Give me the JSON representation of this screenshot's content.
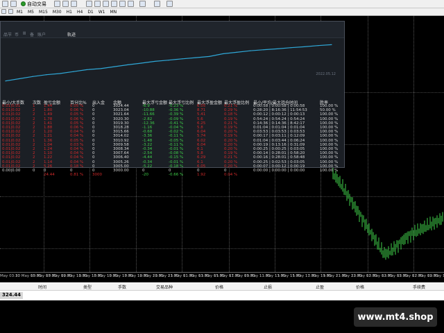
{
  "toolbar": {
    "auto_trading_label": "自动交易",
    "timeframes": [
      "M1",
      "M5",
      "M15",
      "M30",
      "H1",
      "H4",
      "D1",
      "W1",
      "MN"
    ]
  },
  "panel": {
    "tabs": [
      "品",
      "节",
      "币",
      "Ⅲ",
      "备",
      "账户",
      "轨迹"
    ],
    "active_tab_index": 6,
    "equity_date": "2022.05.12"
  },
  "stats": {
    "headers": [
      "最小/大手数",
      "次数",
      "盈亏金额",
      "百分比%",
      "出入金",
      "余额",
      "最大浮亏金额",
      "最大浮亏比例",
      "最大浮盈金额",
      "最大浮盈比例",
      "最小/平均/最大持仓时间",
      "胜率"
    ],
    "rows": [
      [
        "0.01|0.01",
        "1",
        "1.44",
        "0.05 %",
        "0",
        "3024.44",
        "-6.9",
        "-0.23 %",
        "6.05",
        "0.21 %",
        "0:00:58 | 0:00:58 | 0:00:58",
        "100.00 %"
      ],
      [
        "0.01|0.02",
        "2",
        "1.80",
        "0.06 %",
        "0",
        "3023.04",
        "-10.88",
        "-0.36 %",
        "8.71",
        "0.29 %",
        "0:28:20 | 8:16:36 | 11:54:53",
        "50.00 %"
      ],
      [
        "0.01|0.02",
        "2",
        "1.49",
        "0.05 %",
        "0",
        "3021.64",
        "-11.66",
        "-0.39 %",
        "5.41",
        "0.18 %",
        "0:00:12 | 0:00:12 | 0:00:13",
        "100.00 %"
      ],
      [
        "0.01|0.02",
        "2",
        "1.78",
        "0.06 %",
        "0",
        "3020.30",
        "-2.82",
        "-0.09 %",
        "5.6",
        "0.19 %",
        "0:54:24 | 0:54:24 | 0:54:24",
        "100.00 %"
      ],
      [
        "0.01|0.02",
        "2",
        "1.41",
        "0.05 %",
        "0",
        "3019.30",
        "-12.36",
        "-0.41 %",
        "6.25",
        "0.21 %",
        "0:14:36 | 0:14:36 | 8:42:17",
        "100.00 %"
      ],
      [
        "0.01|0.02",
        "2",
        "1.88",
        "0.06 %",
        "0",
        "3018.28",
        "-1.16",
        "-0.04 %",
        "5.8",
        "0.19 %",
        "0:01:04 | 0:01:04 | 0:01:04",
        "100.00 %"
      ],
      [
        "0.01|0.02",
        "2",
        "1.20",
        "0.04 %",
        "0",
        "3015.66",
        "-0.68",
        "-0.02 %",
        "6.04",
        "0.20 %",
        "0:03:53 | 0:03:53 | 0:03:53",
        "100.00 %"
      ],
      [
        "0.01|0.02",
        "2",
        "1.21",
        "0.04 %",
        "0",
        "3014.02",
        "-3.36",
        "-0.11 %",
        "5.74",
        "0.19 %",
        "0:00:17 | 0:03:11 | 0:12:09",
        "100.00 %"
      ],
      [
        "0.01|0.02",
        "1",
        "1.36",
        "0.05 %",
        "0",
        "3010.92",
        "-1.48",
        "-0.05 %",
        "6.02",
        "0.20 %",
        "0:01:04 | 0:03:44 | 0:06:24",
        "100.00 %"
      ],
      [
        "0.01|0.02",
        "2",
        "1.04",
        "0.03 %",
        "0",
        "3009.58",
        "-3.22",
        "-0.11 %",
        "6.04",
        "0.20 %",
        "0:00:19 | 0:13:16 | 0:31:09",
        "100.00 %"
      ],
      [
        "0.01|0.02",
        "2",
        "1.24",
        "0.04 %",
        "0",
        "3008.34",
        "-0.34",
        "-0.01 %",
        "6.1",
        "0.20 %",
        "0:00:25 | 0:00:25 | 0:03:05",
        "100.00 %"
      ],
      [
        "0.01|0.02",
        "2",
        "1.10",
        "0.04 %",
        "0",
        "3007.64",
        "-2.54",
        "-0.08 %",
        "5.8",
        "0.19 %",
        "0:00:14 | 0:28:01 | 0:58:20",
        "100.00 %"
      ],
      [
        "0.01|0.02",
        "2",
        "1.22",
        "0.04 %",
        "0",
        "3006.40",
        "-4.44",
        "-0.15 %",
        "6.29",
        "0.21 %",
        "0:00:16 | 0:28:01 | 0:58:48",
        "100.00 %"
      ],
      [
        "0.01|0.02",
        "2",
        "1.14",
        "0.04 %",
        "0",
        "3005.26",
        "-0.34",
        "-0.01 %",
        "6.1",
        "0.20 %",
        "0:00:25 | 0:02:53 | 0:03:05",
        "100.00 %"
      ],
      [
        "0.01|0.02",
        "2",
        "5.26",
        "0.18 %",
        "0",
        "3005.00",
        "-5.22",
        "-0.18 %",
        "6.05",
        "0.20 %",
        "0:00:07 | 0:00:12 | 0:00:19",
        "100.00 %"
      ],
      [
        "0.00|0.00",
        "0",
        "0",
        "0",
        "0",
        "3000.00",
        "0",
        "0",
        "0",
        "0",
        "0:00:00 | 0:00:00 | 0:00:00",
        "100.00 %"
      ]
    ],
    "totals": [
      "",
      "",
      "24.44",
      "0.81 %",
      "3000",
      "",
      "-20",
      "-0.66 %",
      "1.92",
      "0.04 %",
      "",
      ""
    ]
  },
  "xaxis": {
    "labels": [
      "May 03:30",
      "10 May 05:30",
      "10 May 07:30",
      "10 May 09:30",
      "10 May 11:30",
      "10 May 13:30",
      "10 May 15:30",
      "10 May 17:30",
      "10 May 19:30",
      "10 May 21:30",
      "10 May 23:30",
      "11 May 01:30",
      "11 May 03:30",
      "11 May 05:30",
      "11 May 07:30",
      "11 May 09:30",
      "11 May 11:30",
      "11 May 13:30",
      "11 May 15:30",
      "11 May 17:30",
      "11 May 19:30",
      "11 May 21:30",
      "11 May 23:30",
      "12 May 01:30",
      "12 May 03:30",
      "12 May 05:30",
      "12 May 07:30",
      "12 May 09:30",
      "12 May 11:30"
    ]
  },
  "terminal": {
    "columns": [
      "时间",
      "类型",
      "手数",
      "交易品种",
      "价格",
      "止损",
      "止盈",
      "价格",
      "手续费"
    ],
    "balance": "324.44"
  },
  "watermark": "www.mt4.shop",
  "chart_data": {
    "type": "line",
    "title": "",
    "x": [
      0,
      1,
      2,
      3,
      4,
      5,
      6,
      7,
      8,
      9,
      10,
      11,
      12,
      13,
      14,
      15,
      16,
      17,
      18,
      19,
      20,
      21,
      22,
      23,
      24
    ],
    "series": [
      {
        "values": [
          3000,
          3001.5,
          3003,
          3004.2,
          3005,
          3006.3,
          3007.6,
          3008.3,
          3009.6,
          3010.9,
          3012,
          3013.2,
          3014,
          3014.9,
          3015.7,
          3016.5,
          3018.3,
          3019.3,
          3020.3,
          3021,
          3021.6,
          3022.4,
          3023,
          3023.8,
          3024.4
        ]
      }
    ],
    "ylim": [
      2998,
      3026
    ],
    "grid": false
  },
  "colors": {
    "equity_line": "#2fa8d8",
    "loss": "#d22a2a",
    "profit": "#3fd04a",
    "candle": "#3fd04a"
  }
}
